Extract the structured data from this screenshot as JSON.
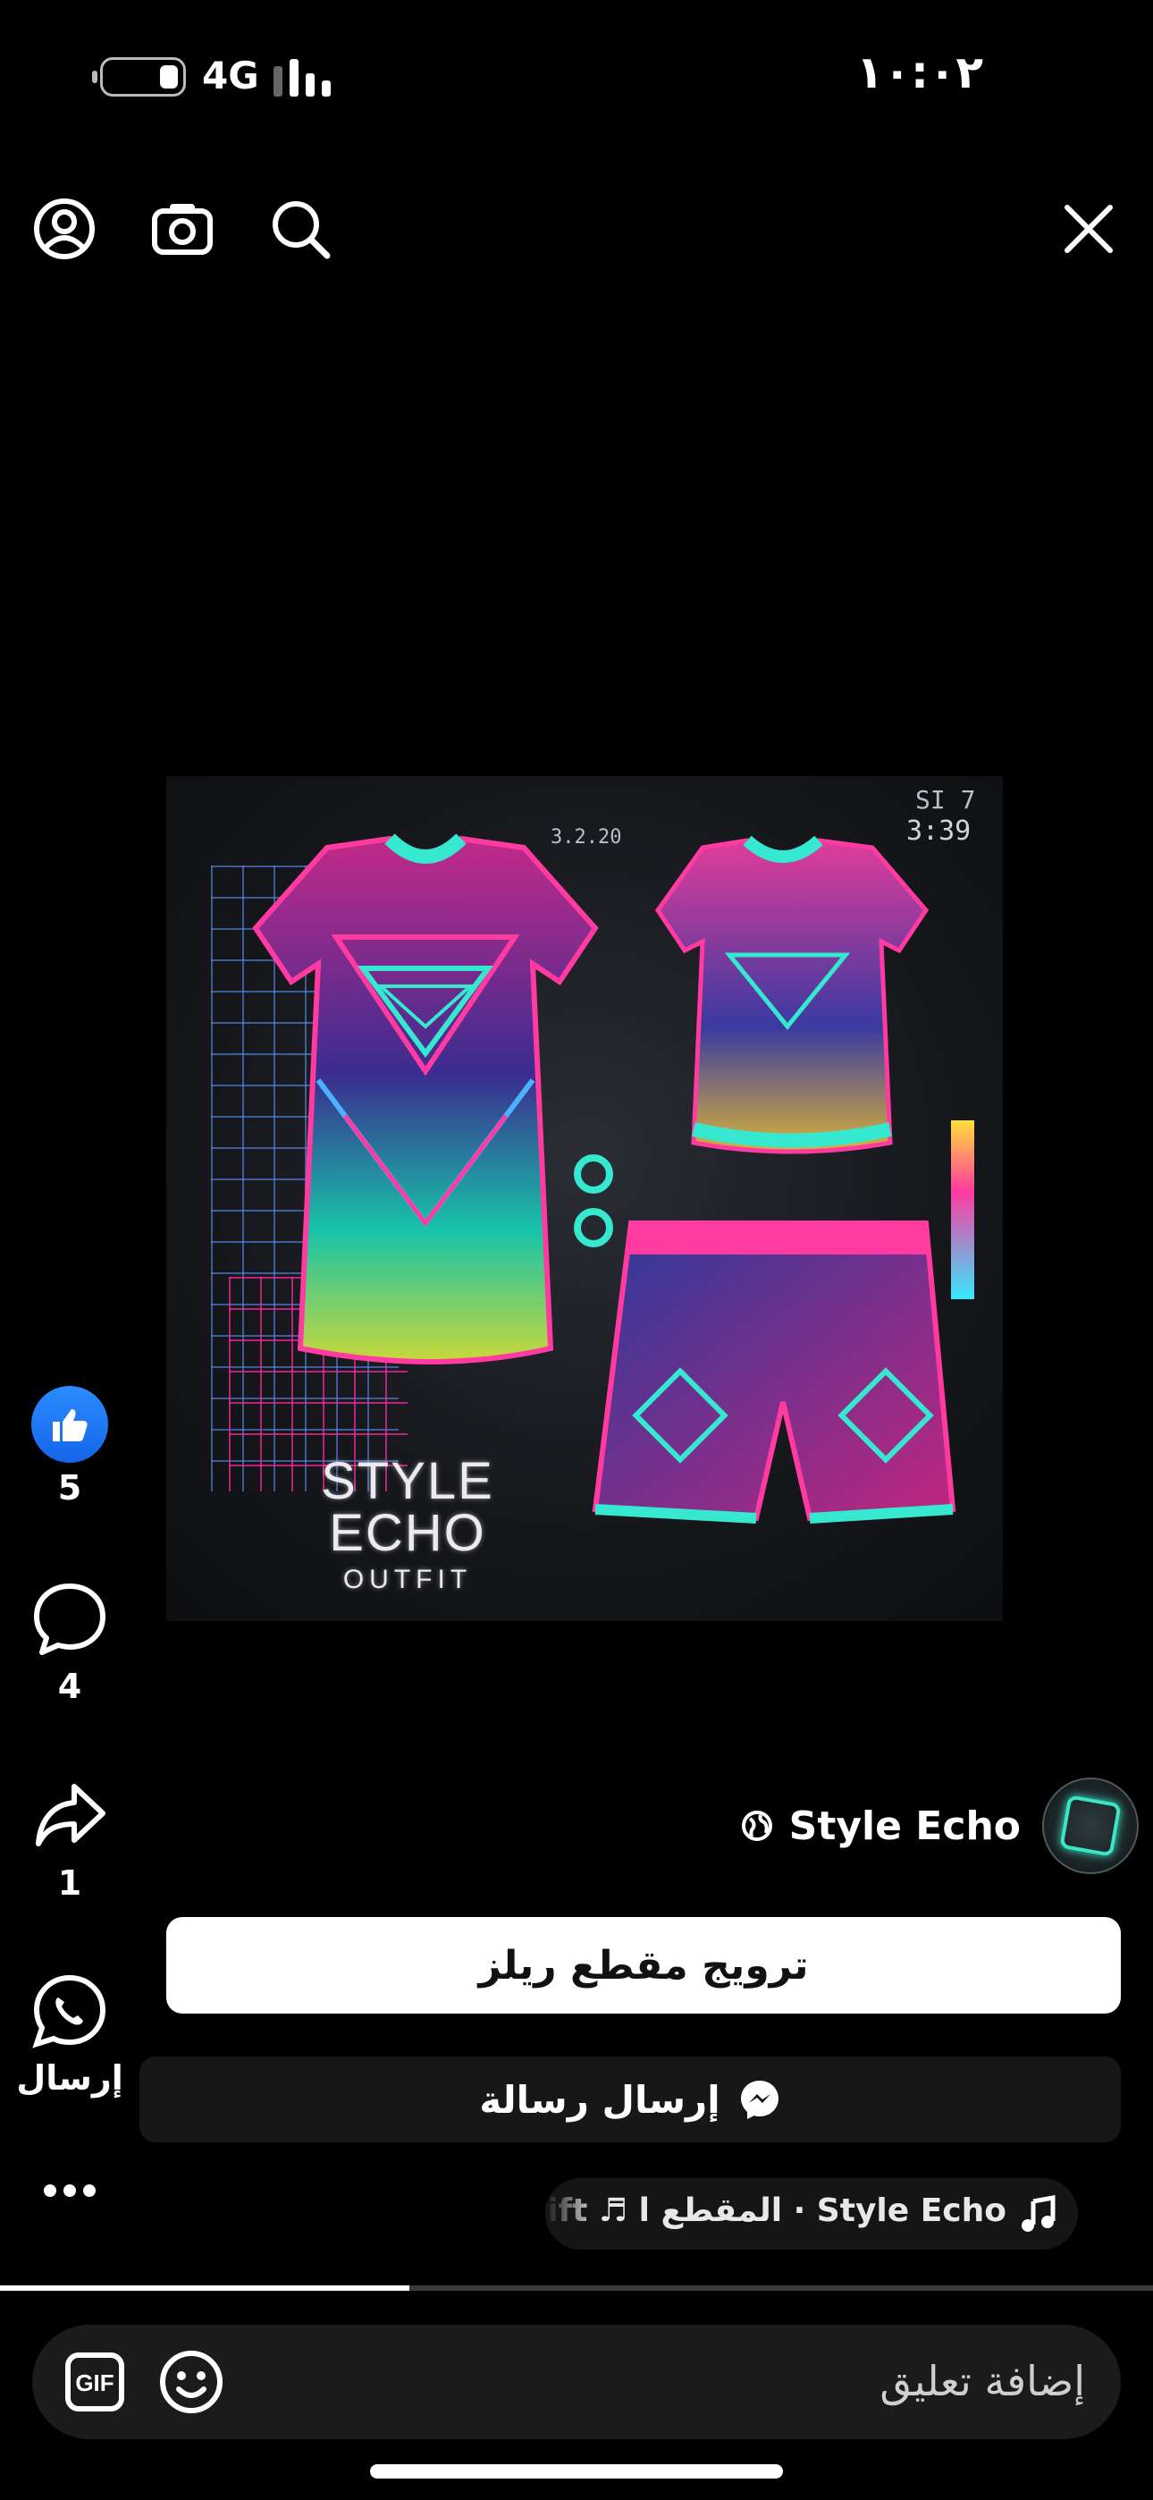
{
  "status_bar": {
    "time": "١٠:٠٢",
    "network": "4G"
  },
  "top_bar": {
    "icons": [
      "close-icon",
      "search-icon",
      "camera-icon",
      "profile-icon"
    ]
  },
  "post": {
    "image_texts": {
      "top_label": "3:39",
      "top_sublabel": "SI 7",
      "mid_label": "3.2.20",
      "brand_line1": "STYLE",
      "brand_line2": "ECHO",
      "brand_line3": "OUTFIT"
    },
    "author": {
      "name": "Style Echo"
    }
  },
  "actions": {
    "like_count": "5",
    "comment_count": "4",
    "share_count": "1",
    "whatsapp_label": "إرسال"
  },
  "buttons": {
    "promote_label": "ترويج مقطع ريلز",
    "send_message_label": "إرسال رسالة"
  },
  "audio": {
    "text": "(Drift ♬ المقطع ا · Style Echo"
  },
  "video_progress": 0.355,
  "comment_bar": {
    "placeholder": "إضافة تعليق"
  },
  "colors": {
    "like_blue": "#1877f2",
    "neon_pink": "#ff2aa0",
    "neon_cyan": "#39e6c6"
  }
}
